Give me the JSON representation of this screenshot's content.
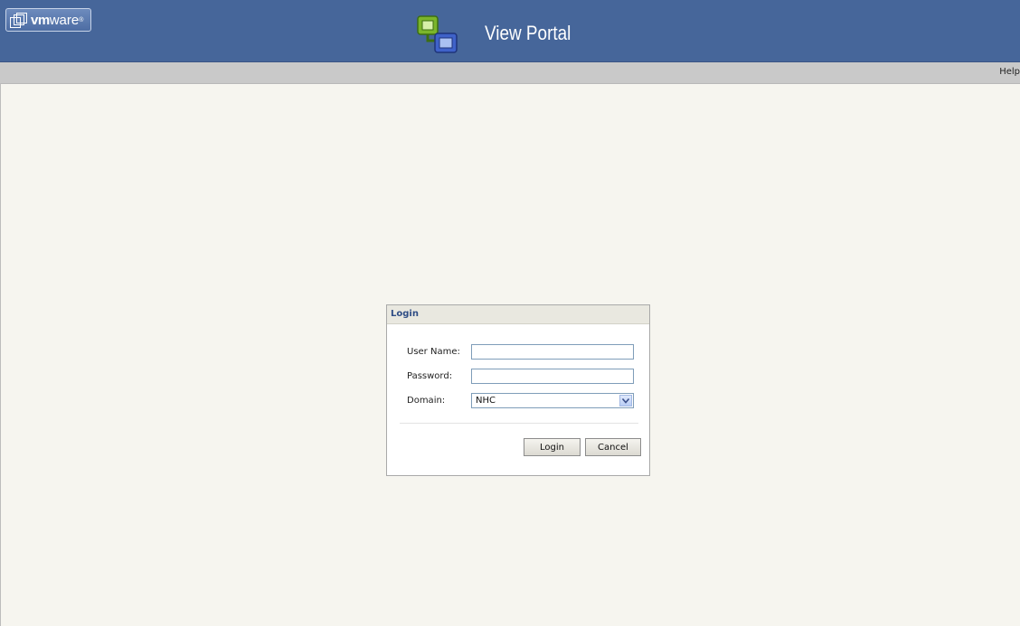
{
  "header": {
    "logo_text_bold": "vm",
    "logo_text_rest": "ware",
    "logo_mark": "®",
    "title": "View Portal",
    "icon": "view-portal-icon",
    "background_color": "#46669a"
  },
  "toolbar": {
    "help_label": "Help"
  },
  "login": {
    "panel_title": "Login",
    "username_label": "User Name:",
    "username_value": "",
    "password_label": "Password:",
    "password_value": "",
    "domain_label": "Domain:",
    "domain_selected": "NHC",
    "login_button": "Login",
    "cancel_button": "Cancel"
  }
}
